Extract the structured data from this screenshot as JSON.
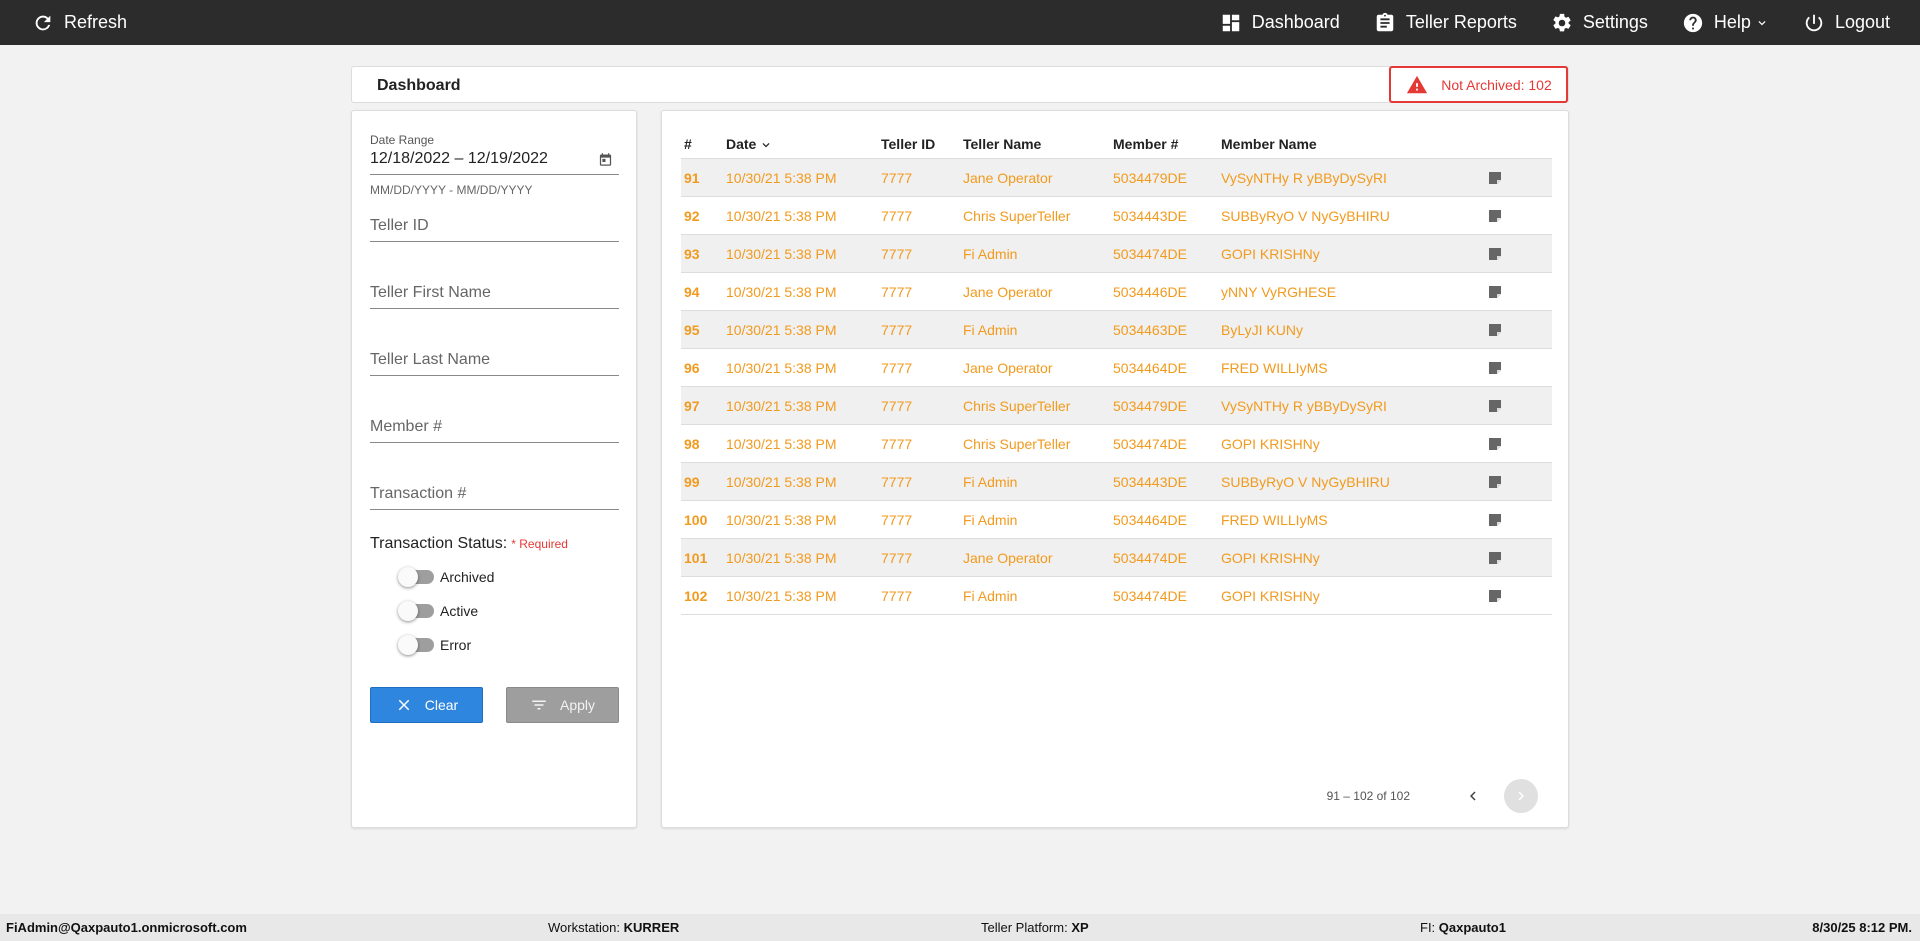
{
  "topbar": {
    "refresh_label": "Refresh",
    "nav": [
      {
        "label": "Dashboard",
        "icon": "dashboard-icon"
      },
      {
        "label": "Teller Reports",
        "icon": "clipboard-icon"
      },
      {
        "label": "Settings",
        "icon": "gear-icon"
      },
      {
        "label": "Help",
        "icon": "help-icon"
      },
      {
        "label": "Logout",
        "icon": "power-icon"
      }
    ]
  },
  "header": {
    "title": "Dashboard",
    "not_archived": "Not Archived: 102",
    "alert_color": "#e53935"
  },
  "filters": {
    "date_range_label": "Date Range",
    "date_range_value": "12/18/2022 – 12/19/2022",
    "date_range_hint": "MM/DD/YYYY - MM/DD/YYYY",
    "teller_id": "Teller ID",
    "teller_first_name": "Teller First Name",
    "teller_last_name": "Teller Last Name",
    "member_num": "Member #",
    "transaction_num": "Transaction #",
    "status_label": "Transaction Status:",
    "required": "* Required",
    "statuses": [
      "Archived",
      "Active",
      "Error"
    ],
    "clear_label": "Clear",
    "apply_label": "Apply"
  },
  "table": {
    "columns": [
      "#",
      "Date",
      "Teller ID",
      "Teller Name",
      "Member #",
      "Member Name"
    ],
    "accent_color": "#f29a1d",
    "rows": [
      {
        "n": "91",
        "date": "10/30/21 5:38 PM",
        "tid": "7777",
        "tname": "Jane Operator",
        "mnum": "5034479DE",
        "mname": "VySyNTHy R yBByDySyRI"
      },
      {
        "n": "92",
        "date": "10/30/21 5:38 PM",
        "tid": "7777",
        "tname": "Chris SuperTeller",
        "mnum": "5034443DE",
        "mname": "SUBByRyO V NyGyBHIRU"
      },
      {
        "n": "93",
        "date": "10/30/21 5:38 PM",
        "tid": "7777",
        "tname": "Fi Admin",
        "mnum": "5034474DE",
        "mname": "GOPI KRISHNy"
      },
      {
        "n": "94",
        "date": "10/30/21 5:38 PM",
        "tid": "7777",
        "tname": "Jane Operator",
        "mnum": "5034446DE",
        "mname": "yNNY VyRGHESE"
      },
      {
        "n": "95",
        "date": "10/30/21 5:38 PM",
        "tid": "7777",
        "tname": "Fi Admin",
        "mnum": "5034463DE",
        "mname": "ByLyJI KUNy"
      },
      {
        "n": "96",
        "date": "10/30/21 5:38 PM",
        "tid": "7777",
        "tname": "Jane Operator",
        "mnum": "5034464DE",
        "mname": "FRED WILLIyMS"
      },
      {
        "n": "97",
        "date": "10/30/21 5:38 PM",
        "tid": "7777",
        "tname": "Chris SuperTeller",
        "mnum": "5034479DE",
        "mname": "VySyNTHy R yBByDySyRI"
      },
      {
        "n": "98",
        "date": "10/30/21 5:38 PM",
        "tid": "7777",
        "tname": "Chris SuperTeller",
        "mnum": "5034474DE",
        "mname": "GOPI KRISHNy"
      },
      {
        "n": "99",
        "date": "10/30/21 5:38 PM",
        "tid": "7777",
        "tname": "Fi Admin",
        "mnum": "5034443DE",
        "mname": "SUBByRyO V NyGyBHIRU"
      },
      {
        "n": "100",
        "date": "10/30/21 5:38 PM",
        "tid": "7777",
        "tname": "Fi Admin",
        "mnum": "5034464DE",
        "mname": "FRED WILLIyMS"
      },
      {
        "n": "101",
        "date": "10/30/21 5:38 PM",
        "tid": "7777",
        "tname": "Jane Operator",
        "mnum": "5034474DE",
        "mname": "GOPI KRISHNy"
      },
      {
        "n": "102",
        "date": "10/30/21 5:38 PM",
        "tid": "7777",
        "tname": "Fi Admin",
        "mnum": "5034474DE",
        "mname": "GOPI KRISHNy"
      }
    ],
    "pagination": "91 – 102 of 102"
  },
  "footer": {
    "user": "FiAdmin@Qaxpauto1.onmicrosoft.com",
    "workstation_label": "Workstation:",
    "workstation": "KURRER",
    "platform_label": "Teller Platform:",
    "platform": "XP",
    "fi_label": "FI:",
    "fi": "Qaxpauto1",
    "datetime": "8/30/25 8:12 PM."
  }
}
